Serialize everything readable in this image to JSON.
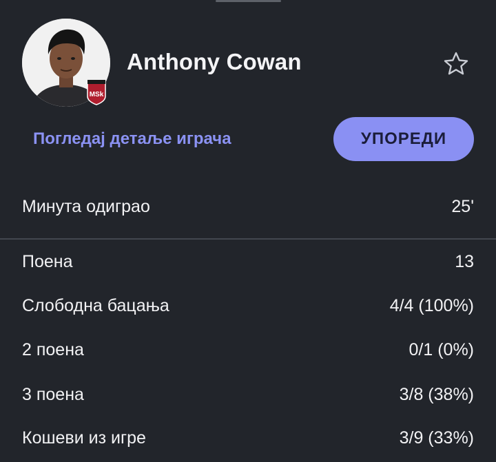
{
  "player": {
    "name": "Anthony Cowan",
    "team_badge_text": "MSk"
  },
  "actions": {
    "details_link": "Погледај детаље играча",
    "compare_button": "УПОРЕДИ",
    "favorite_icon": "star-outline-icon"
  },
  "minutes": {
    "label": "Минута одиграо",
    "value": "25'"
  },
  "stats": [
    {
      "label": "Поена",
      "value": "13"
    },
    {
      "label": "Слободна бацања",
      "value": "4/4 (100%)"
    },
    {
      "label": "2 поена",
      "value": "0/1 (0%)"
    },
    {
      "label": "3 поена",
      "value": "3/8 (38%)"
    },
    {
      "label": "Кошеви из игре",
      "value": "3/9 (33%)"
    }
  ],
  "colors": {
    "background": "#22252b",
    "accent": "#8a90f3",
    "link": "#8b92f3",
    "text": "#f2f2f4",
    "divider": "#43474f"
  }
}
